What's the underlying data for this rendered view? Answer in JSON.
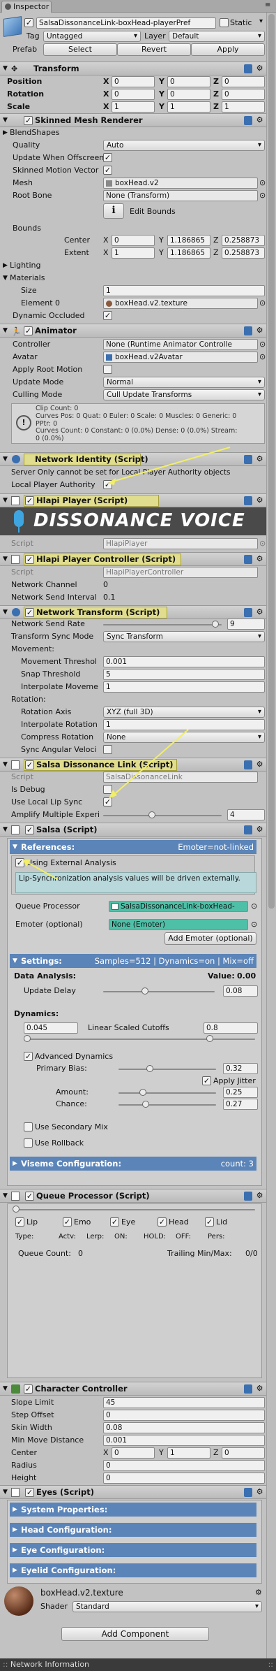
{
  "tab": {
    "label": "Inspector"
  },
  "object": {
    "name": "SalsaDissonanceLink-boxHead-playerPref",
    "static_label": "Static",
    "tag_label": "Tag",
    "tag": "Untagged",
    "layer_label": "Layer",
    "layer": "Default",
    "prefab_label": "Prefab",
    "select": "Select",
    "revert": "Revert",
    "apply": "Apply"
  },
  "transform": {
    "title": "Transform",
    "rows": [
      {
        "label": "Position",
        "x": "0",
        "y": "0",
        "z": "0"
      },
      {
        "label": "Rotation",
        "x": "0",
        "y": "0",
        "z": "0"
      },
      {
        "label": "Scale",
        "x": "1",
        "y": "1",
        "z": "1"
      }
    ]
  },
  "smr": {
    "title": "Skinned Mesh Renderer",
    "blendshapes": "BlendShapes",
    "quality_label": "Quality",
    "quality": "Auto",
    "update_offscreen": "Update When Offscreen",
    "skinned_mv": "Skinned Motion Vector",
    "mesh_label": "Mesh",
    "mesh": "boxHead.v2",
    "rootbone_label": "Root Bone",
    "rootbone": "None (Transform)",
    "edit_bounds": "Edit Bounds",
    "bounds": "Bounds",
    "center_label": "Center",
    "center": {
      "x": "0",
      "y": "1.186865",
      "z": "0.258873"
    },
    "extent_label": "Extent",
    "extent": {
      "x": "1",
      "y": "1.186865",
      "z": "0.258873"
    },
    "lighting": "Lighting",
    "materials": "Materials",
    "size_label": "Size",
    "size": "1",
    "element0_label": "Element 0",
    "element0": "boxHead.v2.texture",
    "dyn_occluded": "Dynamic Occluded"
  },
  "animator": {
    "title": "Animator",
    "controller_label": "Controller",
    "controller": "None (Runtime Animator Controlle",
    "avatar_label": "Avatar",
    "avatar": "boxHead.v2Avatar",
    "apply_root": "Apply Root Motion",
    "update_label": "Update Mode",
    "update": "Normal",
    "culling_label": "Culling Mode",
    "culling": "Cull Update Transforms",
    "info": [
      "Clip Count: 0",
      "Curves Pos: 0 Quat: 0 Euler: 0 Scale: 0 Muscles: 0 Generic: 0",
      "PPtr: 0",
      "Curves Count: 0 Constant: 0 (0.0%) Dense: 0 (0.0%) Stream:",
      "0 (0.0%)"
    ]
  },
  "netid": {
    "title": "Network Identity (Script)",
    "server_only": "Server Only cannot be set for Local Player Authority objects",
    "local_auth": "Local Player Authority"
  },
  "hlapi": {
    "title": "Hlapi Player (Script)",
    "banner": "DISSONANCE VOICE",
    "script_label": "Script",
    "script": "HlapiPlayer"
  },
  "hpc": {
    "title": "Hlapi Player Controller (Script)",
    "script_label": "Script",
    "script": "HlapiPlayerController",
    "channel": "Network Channel",
    "channel_val": "0",
    "interval": "Network Send Interval",
    "interval_val": "0.1"
  },
  "nt": {
    "title": "Network Transform (Script)",
    "send_rate": "Network Send Rate",
    "send_rate_val": "9",
    "sync_mode_label": "Transform Sync Mode",
    "sync_mode": "Sync Transform",
    "movement": "Movement:",
    "move_thr": "Movement Threshol",
    "move_thr_val": "0.001",
    "snap": "Snap Threshold",
    "snap_val": "5",
    "interp_move": "Interpolate Moveme",
    "interp_move_val": "1",
    "rotation": "Rotation:",
    "rot_axis": "Rotation Axis",
    "rot_axis_val": "XYZ (full 3D)",
    "interp_rot": "Interpolate Rotation",
    "interp_rot_val": "1",
    "compress": "Compress Rotation",
    "compress_val": "None",
    "sync_ang": "Sync Angular Veloci"
  },
  "sdl": {
    "title": "Salsa Dissonance Link (Script)",
    "script_label": "Script",
    "script": "SalsaDissonanceLink",
    "debug": "Is Debug",
    "local_lip": "Use Local Lip Sync",
    "amplify": "Amplify Multiple Experi",
    "amplify_val": "4"
  },
  "salsa": {
    "title": "Salsa (Script)",
    "refs": "References:",
    "emoter_state": "Emoter=not-linked",
    "use_ext": "Using External Analysis",
    "note": "Lip-Synchronization analysis values will be driven externally.",
    "queue_label": "Queue Processor",
    "queue": "SalsaDissonanceLink-boxHead-",
    "emoter_label": "Emoter (optional)",
    "emoter": "None (Emoter)",
    "add_emoter": "Add Emoter (optional)",
    "settings": "Settings:",
    "settings_info": "Samples=512 | Dynamics=on | Mix=off",
    "data_analysis": "Data Analysis:",
    "value_label": "Value:",
    "value": "0.00",
    "update_delay": "Update Delay",
    "update_delay_val": "0.08",
    "dynamics": "Dynamics:",
    "dyn_min": "0.045",
    "lin_scaled": "Linear Scaled Cutoffs",
    "dyn_max": "0.8",
    "adv_dyn": "Advanced Dynamics",
    "primary_bias": "Primary Bias:",
    "primary_bias_val": "0.32",
    "apply_jitter": "Apply Jitter",
    "amount": "Amount:",
    "amount_val": "0.25",
    "chance": "Chance:",
    "chance_val": "0.27",
    "secondary_mix": "Use Secondary Mix",
    "rollback": "Use Rollback",
    "viseme": "Viseme Configuration:",
    "viseme_count": "count: 3"
  },
  "qp": {
    "title": "Queue Processor (Script)",
    "cols": [
      "Lip",
      "Emo",
      "Eye",
      "Head",
      "Lid"
    ],
    "type_row": [
      "Type:",
      "Actv:",
      "Lerp:",
      "ON:",
      "HOLD:",
      "OFF:",
      "Pers:"
    ],
    "queue_count": "Queue Count:",
    "queue_count_val": "0",
    "trailing": "Trailing Min/Max:",
    "trailing_val": "0/0"
  },
  "cc": {
    "title": "Character Controller",
    "slope": "Slope Limit",
    "slope_val": "45",
    "step": "Step Offset",
    "step_val": "0",
    "skin": "Skin Width",
    "skin_val": "0.08",
    "minmove": "Min Move Distance",
    "minmove_val": "0.001",
    "center": "Center",
    "center_val": {
      "x": "0",
      "y": "1",
      "z": "0"
    },
    "radius": "Radius",
    "radius_val": "0",
    "height": "Height",
    "height_val": "0"
  },
  "eyes": {
    "title": "Eyes (Script)",
    "sections": [
      "System Properties:",
      "Head Configuration:",
      "Eye Configuration:",
      "Eyelid Configuration:"
    ]
  },
  "material": {
    "name": "boxHead.v2.texture",
    "shader_label": "Shader",
    "shader": "Standard"
  },
  "add_component": "Add Component",
  "footer": "Network Information",
  "colors": {
    "highlight": "#e0dd8e",
    "band": "#5b84b8",
    "teal": "#4fc0a8",
    "note_bg": "#b8d8dc"
  }
}
